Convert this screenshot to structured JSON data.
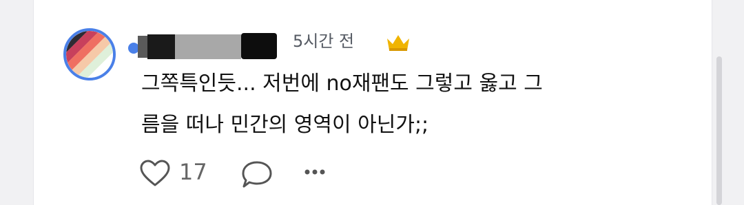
{
  "comment": {
    "time": "5시간 전",
    "lines": [
      "그쪽특인듯... 저번에 no재팬도 그렇고 옳고 그",
      "름을 떠나 민간의 영역이 아닌가;;"
    ],
    "like_count": "17"
  },
  "icons": {
    "author_badge": "crown-icon",
    "like": "heart-icon",
    "reply": "speech-bubble-icon",
    "more": "more-dots-icon"
  },
  "colors": {
    "avatar_ring": "#4a80e8",
    "crown": "#f0b400",
    "text": "#111111",
    "muted": "#666666"
  }
}
